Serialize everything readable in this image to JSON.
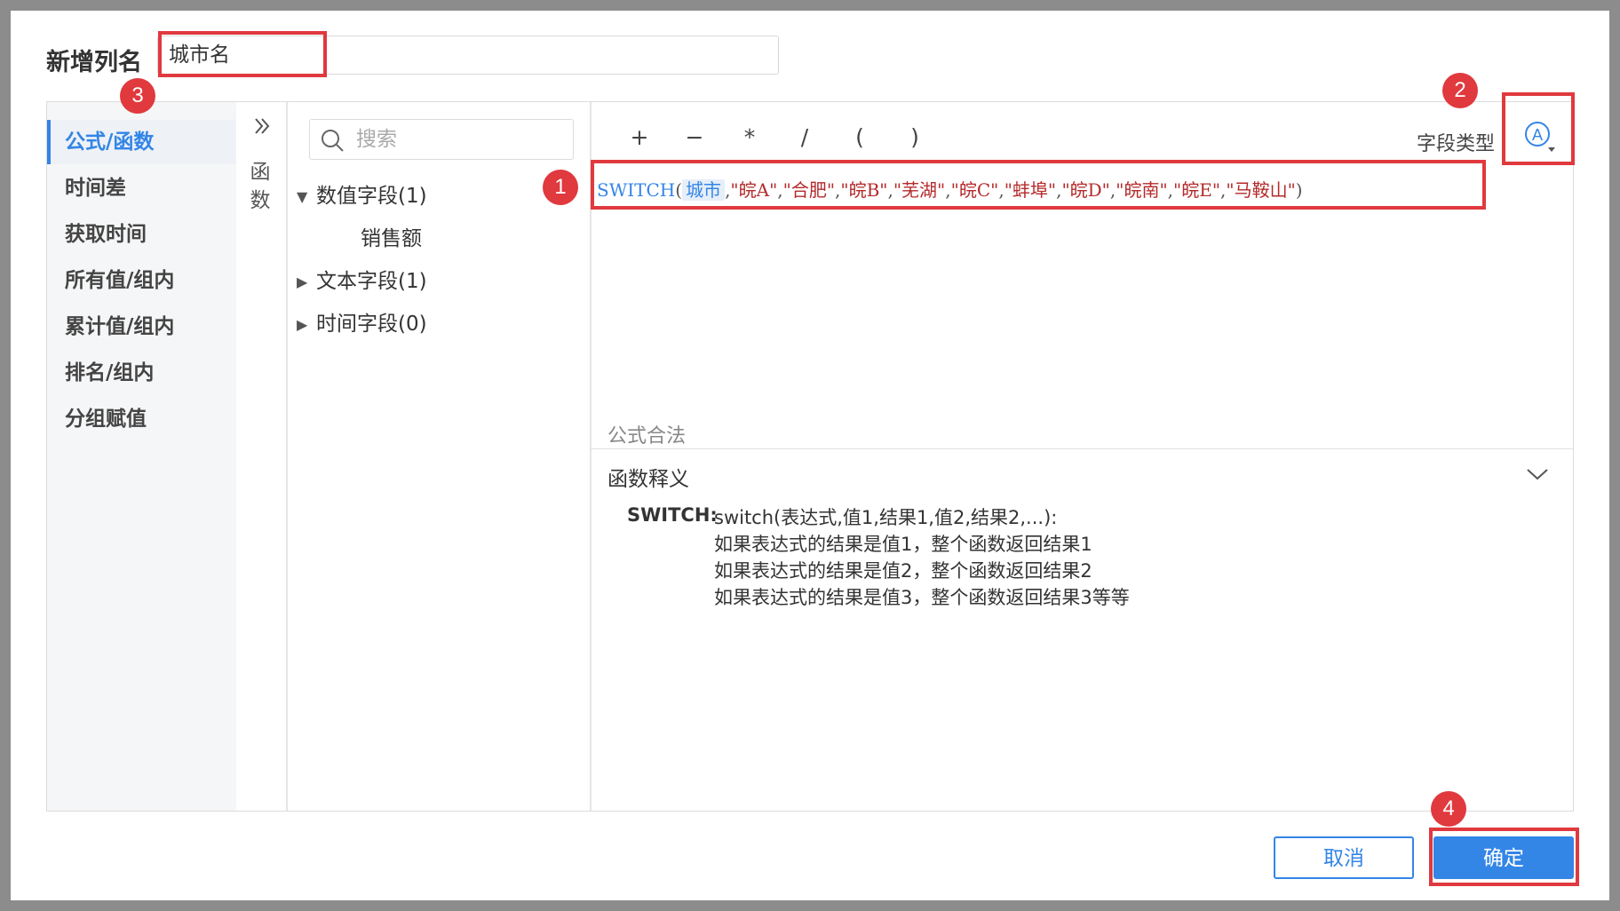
{
  "dialog": {
    "title": "新增列名",
    "column_name_value": "城市名"
  },
  "categories": [
    {
      "label": "公式/函数",
      "active": true
    },
    {
      "label": "时间差",
      "active": false
    },
    {
      "label": "获取时间",
      "active": false
    },
    {
      "label": "所有值/组内",
      "active": false
    },
    {
      "label": "累计值/组内",
      "active": false
    },
    {
      "label": "排名/组内",
      "active": false
    },
    {
      "label": "分组赋值",
      "active": false
    }
  ],
  "function_panel": {
    "toggle_icon": "double-chevron-right-icon",
    "label_chars": [
      "函",
      "数"
    ]
  },
  "fields": {
    "search_placeholder": "搜索",
    "groups": [
      {
        "label": "数值字段(1)",
        "expanded": true,
        "items": [
          "销售额"
        ]
      },
      {
        "label": "文本字段(1)",
        "expanded": false,
        "items": []
      },
      {
        "label": "时间字段(0)",
        "expanded": false,
        "items": []
      }
    ]
  },
  "editor": {
    "operators": [
      "+",
      "−",
      "*",
      "/",
      "(",
      ")"
    ],
    "field_type_label": "字段类型",
    "field_type_icon": "text-type-icon",
    "formula": {
      "function": "SWITCH",
      "field": "城市",
      "strings": [
        "\"皖A\"",
        "\"合肥\"",
        "\"皖B\"",
        "\"芜湖\"",
        "\"皖C\"",
        "\"蚌埠\"",
        "\"皖D\"",
        "\"皖南\"",
        "\"皖E\"",
        "\"马鞍山\""
      ]
    },
    "validity": "公式合法"
  },
  "explanation": {
    "title": "函数释义",
    "keyword": "SWITCH:",
    "lines": [
      "switch(表达式,值1,结果1,值2,结果2,...):",
      "如果表达式的结果是值1，整个函数返回结果1",
      "如果表达式的结果是值2，整个函数返回结果2",
      "如果表达式的结果是值3，整个函数返回结果3等等"
    ]
  },
  "buttons": {
    "cancel": "取消",
    "ok": "确定"
  },
  "annotations": {
    "badge_1": "1",
    "badge_2": "2",
    "badge_3": "3",
    "badge_4": "4",
    "highlight_color": "#e0393e"
  },
  "colors": {
    "accent": "#3385e6",
    "string": "#b42a2a"
  }
}
